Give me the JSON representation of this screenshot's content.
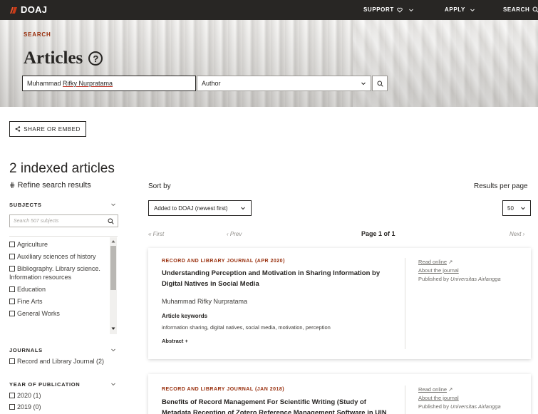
{
  "brand": {
    "name": "DOAJ",
    "color": "#982e0c"
  },
  "nav": {
    "support": "SUPPORT",
    "apply": "APPLY",
    "search": "SEARCH"
  },
  "hero": {
    "kicker": "SEARCH",
    "title": "Articles",
    "query_first": "Muhammad ",
    "query_second": "Rifky Nurpratama",
    "field": "Author"
  },
  "share_label": "SHARE OR EMBED",
  "results_count": "2 indexed articles",
  "refine_label": "Refine search results",
  "sidebar": {
    "subjects_label": "SUBJECTS",
    "subjects_placeholder": "Search 507 subjects",
    "subjects": [
      "Agriculture",
      "Auxiliary sciences of history",
      "Bibliography. Library science. Information resources",
      "Education",
      "Fine Arts",
      "General Works"
    ],
    "journals_label": "JOURNALS",
    "journal_item": "Record and Library Journal (2)",
    "year_label": "YEAR OF PUBLICATION",
    "years": [
      "2020 (1)",
      "2019 (0)"
    ]
  },
  "sort": {
    "label": "Sort by",
    "value": "Added to DOAJ (newest first)"
  },
  "rpp": {
    "label": "Results per page",
    "value": "50"
  },
  "pagination": {
    "first": "First",
    "prev": "Prev",
    "page": "Page 1 of 1",
    "next": "Next"
  },
  "articles": [
    {
      "journal": "RECORD AND LIBRARY JOURNAL (APR 2020)",
      "title": "Understanding Perception and Motivation in Sharing Information by Digital Natives in Social Media",
      "author": "Muhammad Rifky Nurpratama",
      "keywords_label": "Article keywords",
      "keywords": "information sharing, digital natives, social media, motivation, perception",
      "abstract": "Abstract",
      "read_online": "Read online",
      "about": "About the journal",
      "published_by": "Published by",
      "publisher": "Universitas Airlangga"
    },
    {
      "journal": "RECORD AND LIBRARY JOURNAL (JAN 2018)",
      "title": "Benefits of Record Management For Scientific Writing (Study of Metadata Reception of Zotero Reference Management Software in UIN",
      "read_online": "Read online",
      "about": "About the journal",
      "published_by": "Published by",
      "publisher": "Universitas Airlangga"
    }
  ]
}
